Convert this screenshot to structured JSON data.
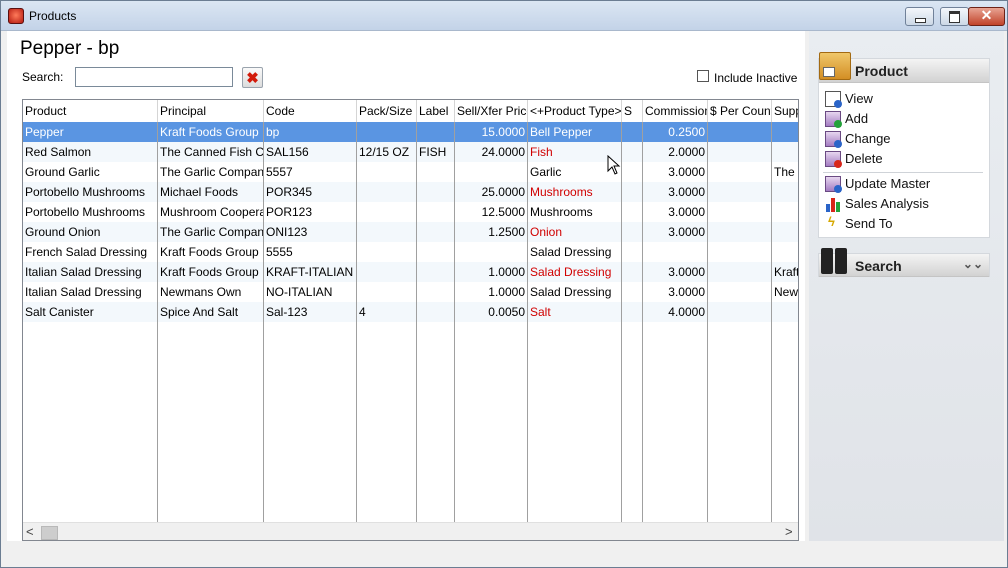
{
  "window": {
    "title": "Products"
  },
  "page": {
    "title": "Pepper - bp",
    "search_label": "Search:",
    "search_value": "",
    "include_inactive_label": "Include Inactive"
  },
  "grid": {
    "columns": [
      "Product",
      "Principal",
      "Code",
      "Pack/Size",
      "Label",
      "Sell/Xfer Price",
      "<+Product Type>",
      "S",
      "Commission",
      "$ Per Count",
      "Supp"
    ],
    "rows": [
      {
        "product": "Pepper",
        "principal": "Kraft Foods Group",
        "code": "bp",
        "pack": "",
        "label": "",
        "price": "15.0000",
        "type": "Bell Pepper",
        "s": "",
        "commission": "0.2500",
        "per_count": "",
        "supp": ""
      },
      {
        "product": "Red Salmon",
        "principal": "The Canned Fish Com",
        "code": "SAL156",
        "pack": "12/15 OZ",
        "label": "FISH",
        "price": "24.0000",
        "type": "Fish",
        "s": "",
        "commission": "2.0000",
        "per_count": "",
        "supp": ""
      },
      {
        "product": "Ground Garlic",
        "principal": "The Garlic Company",
        "code": "5557",
        "pack": "",
        "label": "",
        "price": "",
        "type": "Garlic",
        "s": "",
        "commission": "3.0000",
        "per_count": "",
        "supp": "The G"
      },
      {
        "product": "Portobello Mushrooms",
        "principal": "Michael Foods",
        "code": "POR345",
        "pack": "",
        "label": "",
        "price": "25.0000",
        "type": "Mushrooms",
        "s": "",
        "commission": "3.0000",
        "per_count": "",
        "supp": ""
      },
      {
        "product": "Portobello Mushrooms",
        "principal": "Mushroom Cooperativ",
        "code": "POR123",
        "pack": "",
        "label": "",
        "price": "12.5000",
        "type": "Mushrooms",
        "s": "",
        "commission": "3.0000",
        "per_count": "",
        "supp": ""
      },
      {
        "product": "Ground Onion",
        "principal": "The Garlic Company",
        "code": "ONI123",
        "pack": "",
        "label": "",
        "price": "1.2500",
        "type": "Onion",
        "s": "",
        "commission": "3.0000",
        "per_count": "",
        "supp": ""
      },
      {
        "product": "French Salad Dressing",
        "principal": "Kraft Foods Group",
        "code": "5555",
        "pack": "",
        "label": "",
        "price": "",
        "type": "Salad Dressing",
        "s": "",
        "commission": "",
        "per_count": "",
        "supp": ""
      },
      {
        "product": "Italian Salad Dressing",
        "principal": "Kraft Foods Group",
        "code": "KRAFT-ITALIAN",
        "pack": "",
        "label": "",
        "price": "1.0000",
        "type": "Salad Dressing",
        "s": "",
        "commission": "3.0000",
        "per_count": "",
        "supp": "Kraft"
      },
      {
        "product": "Italian Salad Dressing",
        "principal": "Newmans Own",
        "code": "NO-ITALIAN",
        "pack": "",
        "label": "",
        "price": "1.0000",
        "type": "Salad Dressing",
        "s": "",
        "commission": "3.0000",
        "per_count": "",
        "supp": "Newm"
      },
      {
        "product": "Salt Canister",
        "principal": "Spice And Salt",
        "code": "Sal-123",
        "pack": "4",
        "label": "",
        "price": "0.0050",
        "type": "Salt",
        "s": "",
        "commission": "4.0000",
        "per_count": "",
        "supp": ""
      }
    ]
  },
  "sidebar": {
    "product_panel": {
      "title": "Product",
      "items": [
        "View",
        "Add",
        "Change",
        "Delete"
      ],
      "items2": [
        "Update Master",
        "Sales Analysis",
        "Send To"
      ]
    },
    "search_panel": {
      "title": "Search"
    }
  },
  "colors": {
    "selected_row": "#5a95e2",
    "red_type": "#d00000"
  }
}
